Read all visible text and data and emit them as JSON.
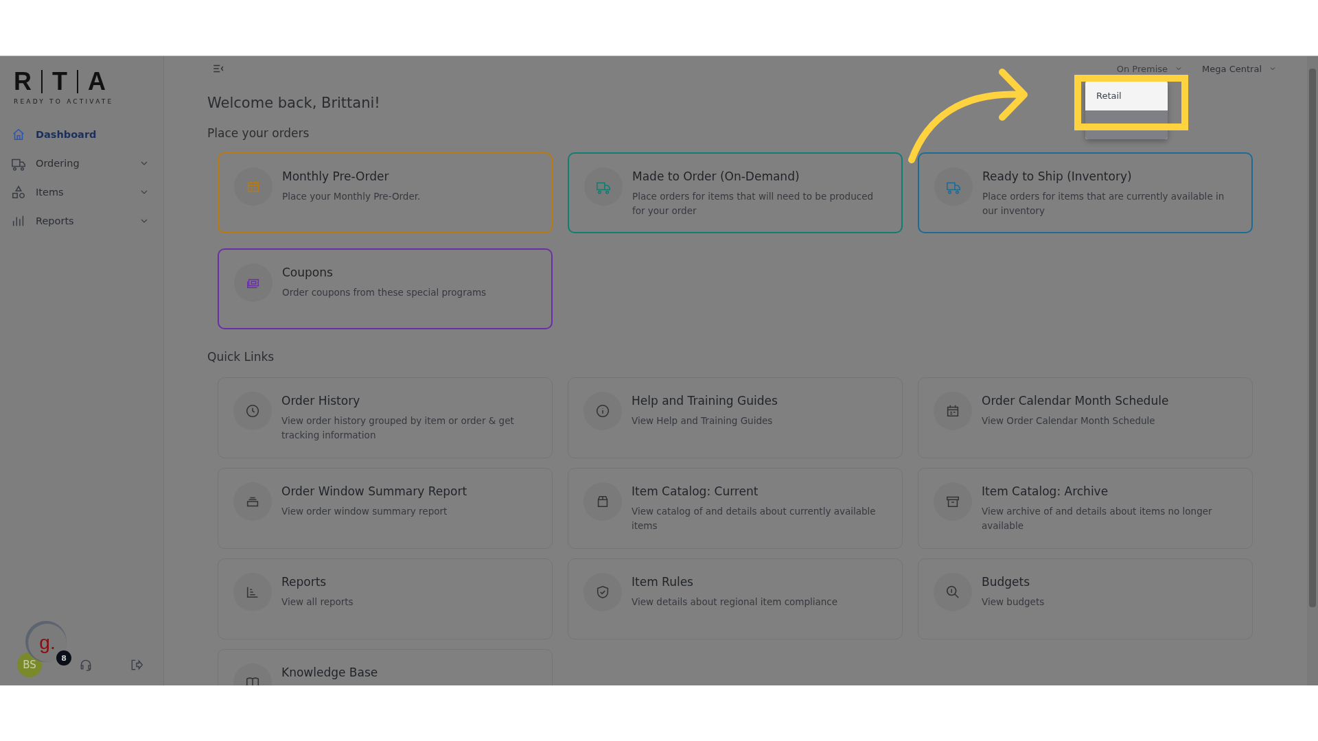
{
  "logo": {
    "letters": [
      "R",
      "T",
      "A"
    ],
    "tagline": "READY TO ACTIVATE"
  },
  "sidebar": {
    "items": [
      {
        "label": "Dashboard",
        "selected": true,
        "expandable": false
      },
      {
        "label": "Ordering",
        "selected": false,
        "expandable": true
      },
      {
        "label": "Items",
        "selected": false,
        "expandable": true
      },
      {
        "label": "Reports",
        "selected": false,
        "expandable": true
      }
    ],
    "avatar_initials": "BS",
    "chat_widget_label": "g.",
    "chat_badge": "8"
  },
  "header": {
    "selectors": [
      {
        "label": "On Premise",
        "open": true
      },
      {
        "label": "Mega Central",
        "open": false
      }
    ]
  },
  "dropdown": {
    "items": [
      {
        "label": "Retail"
      }
    ]
  },
  "welcome": "Welcome back, Brittani!",
  "orders_heading": "Place your orders",
  "order_cards": [
    {
      "title": "Monthly Pre-Order",
      "description": "Place your Monthly Pre-Order.",
      "color": "#b97a12"
    },
    {
      "title": "Made to Order (On-Demand)",
      "description": "Place orders for items that will need to be produced for your order",
      "color": "#0f7d72"
    },
    {
      "title": "Ready to Ship (Inventory)",
      "description": "Place orders for items that are currently available in our inventory",
      "color": "#1d6a95"
    },
    {
      "title": "Coupons",
      "description": "Order coupons from these special programs",
      "color": "#6a2fa6"
    }
  ],
  "quick_links_heading": "Quick Links",
  "quick_links": [
    {
      "title": "Order History",
      "description": "View order history grouped by item or order & get tracking information"
    },
    {
      "title": "Help and Training Guides",
      "description": "View Help and Training Guides"
    },
    {
      "title": "Order Calendar Month Schedule",
      "description": "View Order Calendar Month Schedule"
    },
    {
      "title": "Order Window Summary Report",
      "description": "View order window summary report"
    },
    {
      "title": "Item Catalog: Current",
      "description": "View catalog of and details about currently available items"
    },
    {
      "title": "Item Catalog: Archive",
      "description": "View archive of and details about items no longer available"
    },
    {
      "title": "Reports",
      "description": "View all reports"
    },
    {
      "title": "Item Rules",
      "description": "View details about regional item compliance"
    },
    {
      "title": "Budgets",
      "description": "View budgets"
    },
    {
      "title": "Knowledge Base"
    }
  ]
}
